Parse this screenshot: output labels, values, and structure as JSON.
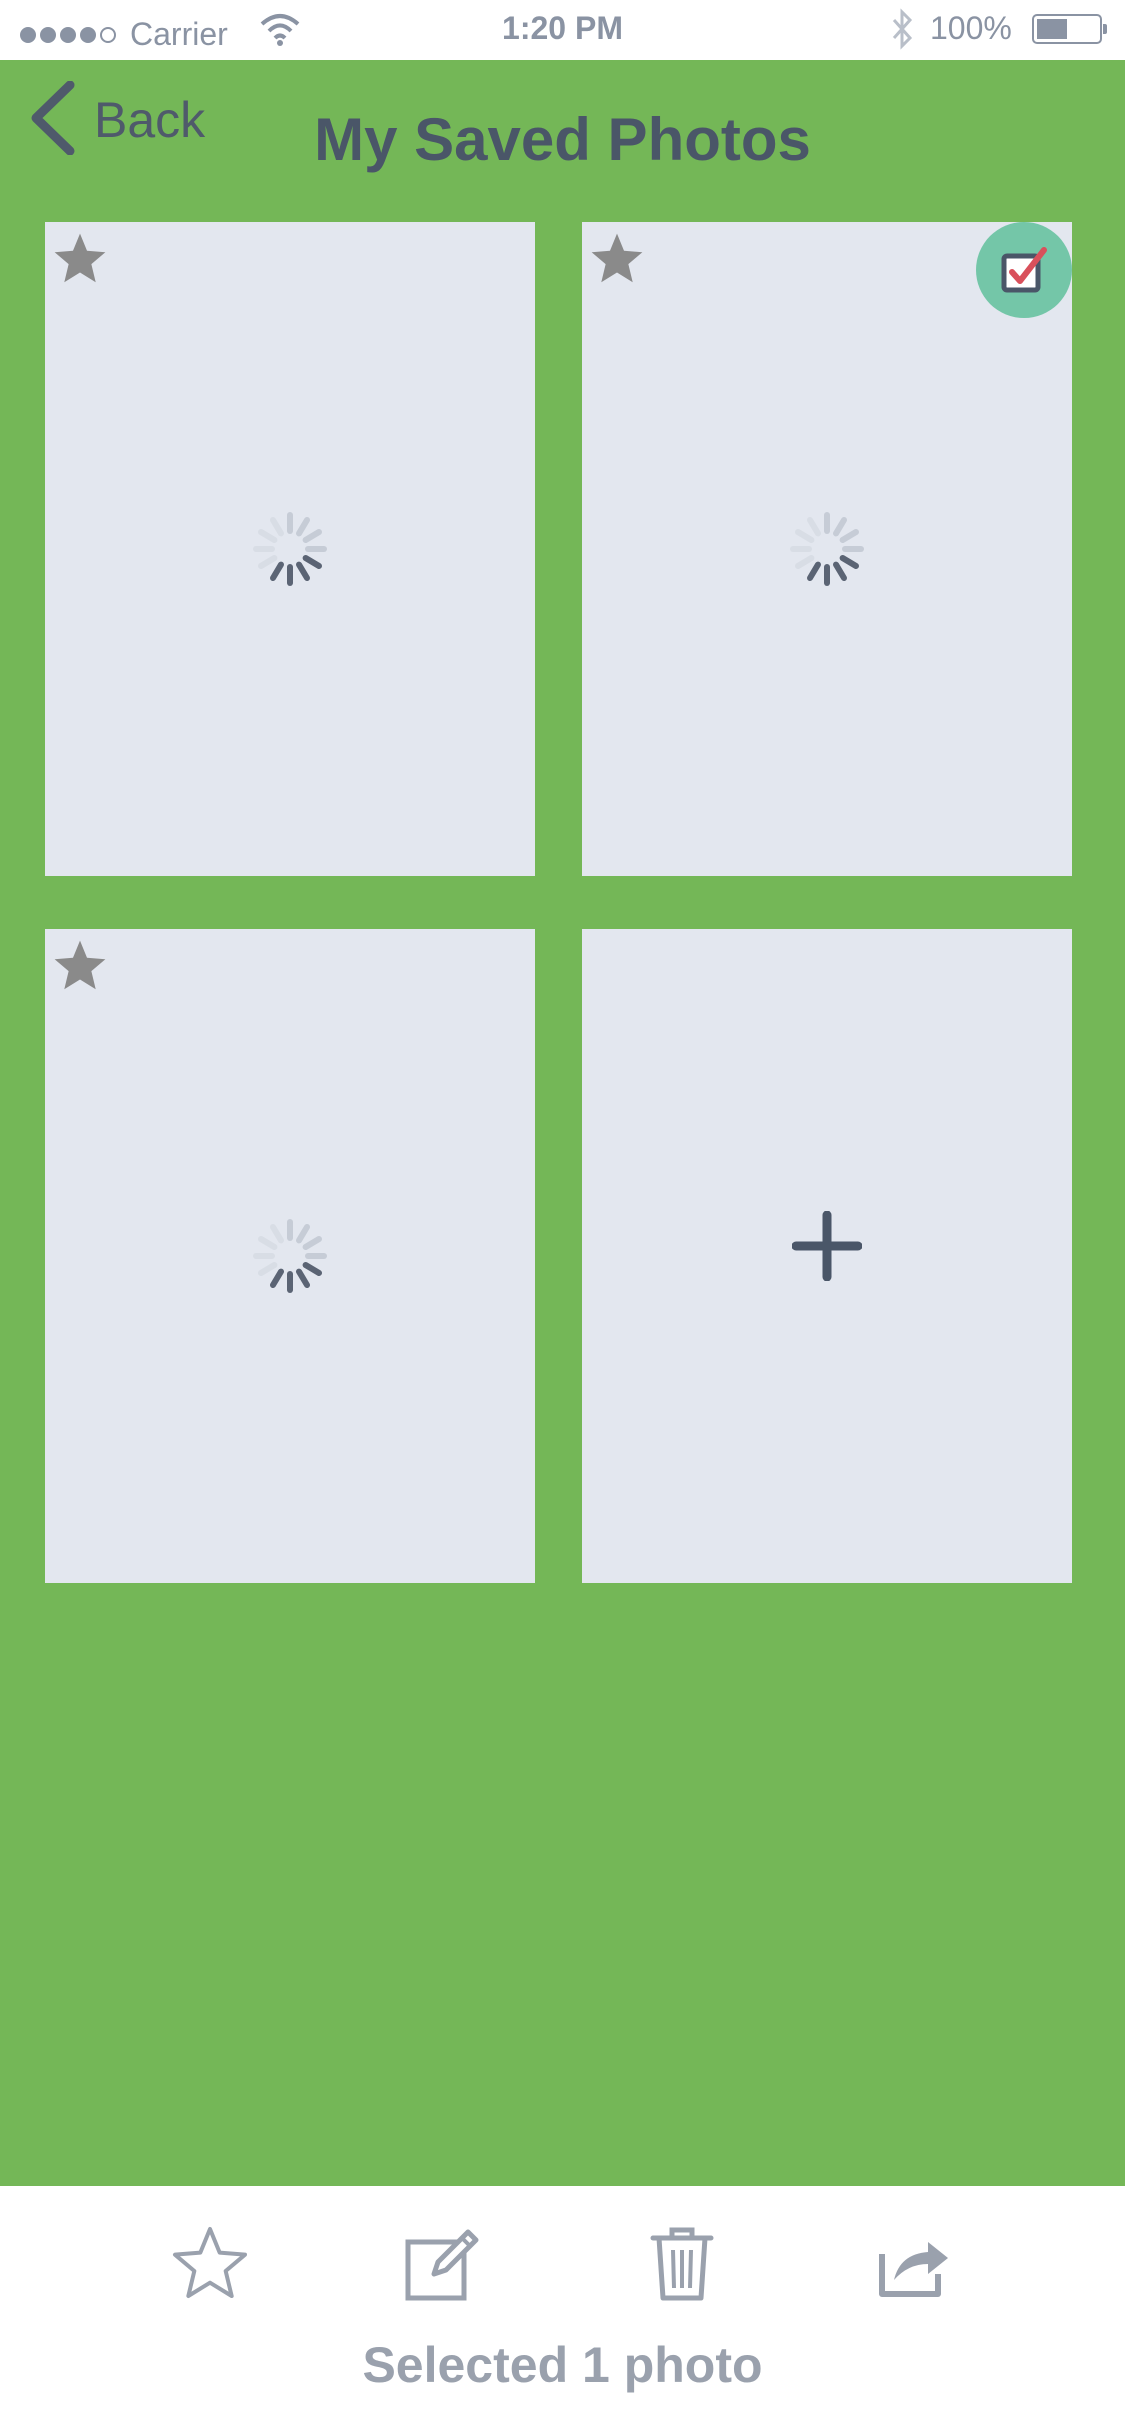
{
  "status_bar": {
    "carrier": "Carrier",
    "time": "1:20 PM",
    "battery": "100%"
  },
  "nav": {
    "back_label": "Back",
    "title": "My Saved Photos"
  },
  "photos": [
    {
      "state": "loading",
      "starred": true,
      "selected": false
    },
    {
      "state": "loading",
      "starred": true,
      "selected": true
    },
    {
      "state": "loading",
      "starred": true,
      "selected": false
    },
    {
      "state": "add",
      "starred": false,
      "selected": false
    }
  ],
  "toolbar": {
    "icons": [
      "star-icon",
      "edit-icon",
      "trash-icon",
      "share-icon"
    ],
    "status_text": "Selected 1 photo"
  },
  "colors": {
    "background": "#74b757",
    "tile": "#e3e7ef",
    "title": "#4a5668",
    "check_badge": "#74c6a8",
    "check_mark": "#d9505b"
  }
}
